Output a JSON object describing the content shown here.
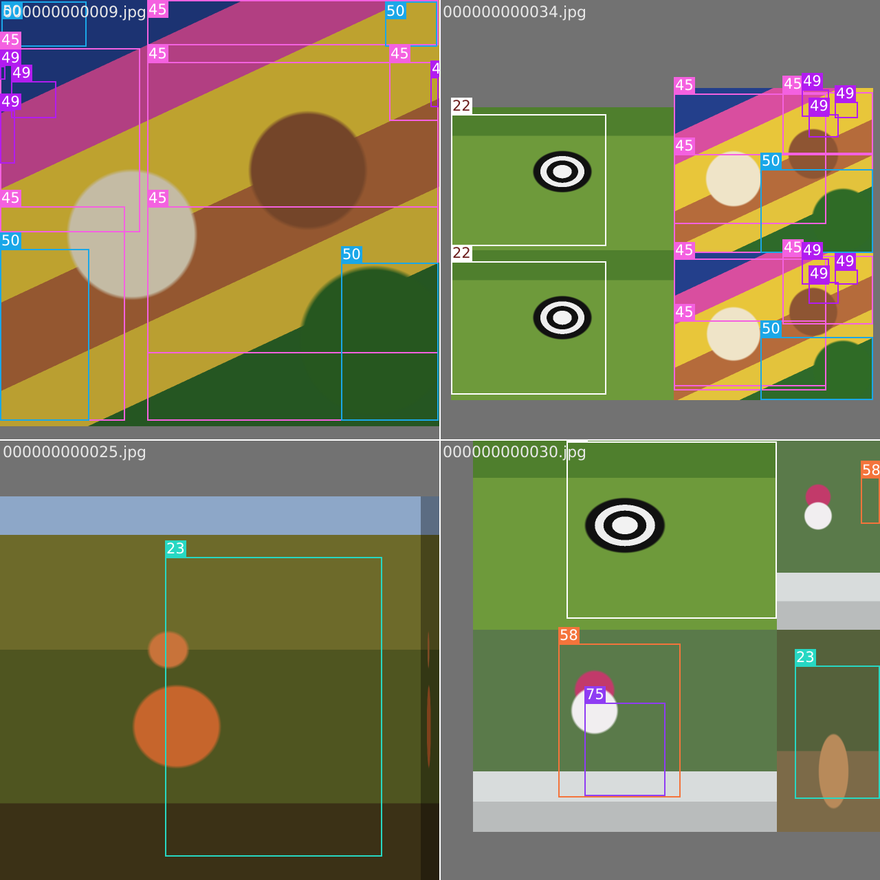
{
  "tiles": [
    {
      "title": "000000000009.jpg"
    },
    {
      "title": "000000000034.jpg"
    },
    {
      "title": "000000000025.jpg"
    },
    {
      "title": "000000000030.jpg"
    }
  ],
  "labels": {
    "zebra": "22",
    "giraffe": "23",
    "bowl": "45",
    "orange": "49",
    "broccoli": "50",
    "potted_plant": "58",
    "vase": "75"
  },
  "colors": {
    "22": "#ffffff",
    "23": "#27d8c3",
    "45": "#f461e0",
    "49": "#b21cf0",
    "50": "#1aa7e8",
    "58": "#f4743b",
    "75": "#8f3cf3"
  }
}
